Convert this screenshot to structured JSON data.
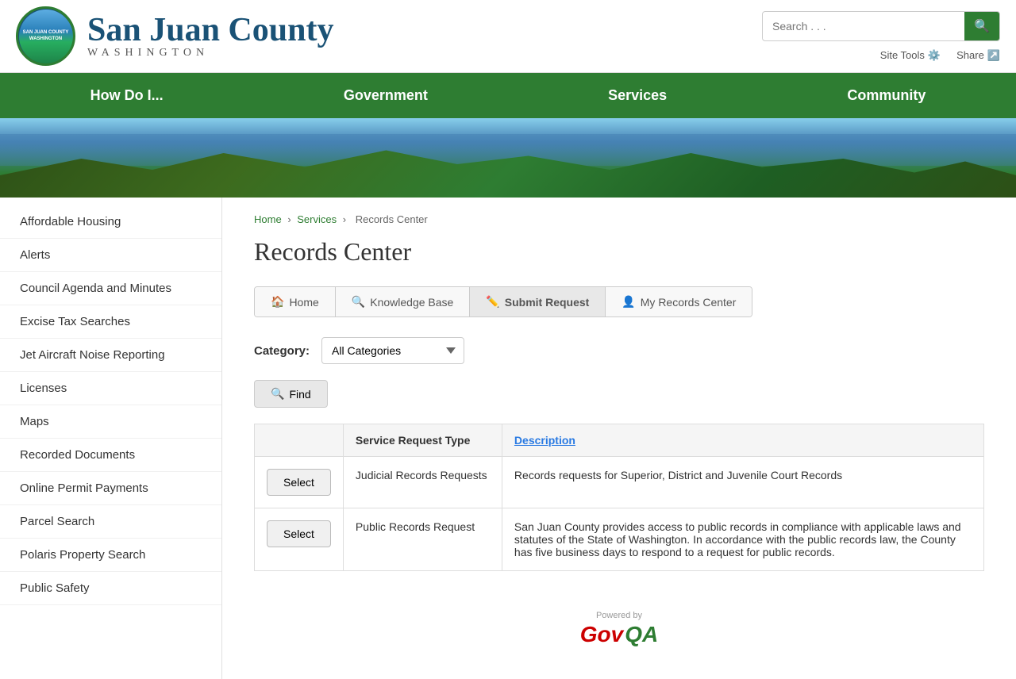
{
  "header": {
    "county_name": "San Juan County",
    "state_name": "WASHINGTON",
    "logo_text": "SAN JUAN COUNTY\nWASHINGTON",
    "search_placeholder": "Search . . .",
    "site_tools_label": "Site Tools",
    "share_label": "Share"
  },
  "nav": {
    "items": [
      {
        "label": "How Do I...",
        "id": "how-do-i"
      },
      {
        "label": "Government",
        "id": "government"
      },
      {
        "label": "Services",
        "id": "services"
      },
      {
        "label": "Community",
        "id": "community"
      }
    ]
  },
  "breadcrumb": {
    "items": [
      {
        "label": "Home",
        "href": "#"
      },
      {
        "label": "Services",
        "href": "#"
      },
      {
        "label": "Records Center",
        "href": "#"
      }
    ]
  },
  "sidebar": {
    "items": [
      {
        "label": "Affordable Housing"
      },
      {
        "label": "Alerts"
      },
      {
        "label": "Council Agenda and Minutes"
      },
      {
        "label": "Excise Tax Searches"
      },
      {
        "label": "Jet Aircraft Noise Reporting"
      },
      {
        "label": "Licenses"
      },
      {
        "label": "Maps"
      },
      {
        "label": "Recorded Documents"
      },
      {
        "label": "Online Permit Payments"
      },
      {
        "label": "Parcel Search"
      },
      {
        "label": "Polaris Property Search"
      },
      {
        "label": "Public Safety"
      }
    ]
  },
  "page": {
    "title": "Records Center",
    "tabs": [
      {
        "label": "Home",
        "icon": "🏠",
        "active": false
      },
      {
        "label": "Knowledge Base",
        "icon": "🔍",
        "active": false
      },
      {
        "label": "Submit Request",
        "icon": "✏️",
        "active": true
      },
      {
        "label": "My Records Center",
        "icon": "👤",
        "active": false
      }
    ],
    "category_label": "Category:",
    "category_default": "All Categories",
    "find_btn_label": "Find",
    "table": {
      "col_action": "",
      "col_type": "Service Request Type",
      "col_desc": "Description",
      "rows": [
        {
          "select_label": "Select",
          "type": "Judicial Records Requests",
          "description": "Records requests for Superior, District and Juvenile Court Records"
        },
        {
          "select_label": "Select",
          "type": "Public Records Request",
          "description": "San Juan County provides access to public records in compliance with applicable laws and statutes of the State of Washington. In accordance with the public records law, the County has five business days to respond to a request for public records."
        }
      ]
    }
  },
  "footer": {
    "powered_by": "Powered by",
    "gov": "Gov",
    "qa": "QA"
  }
}
